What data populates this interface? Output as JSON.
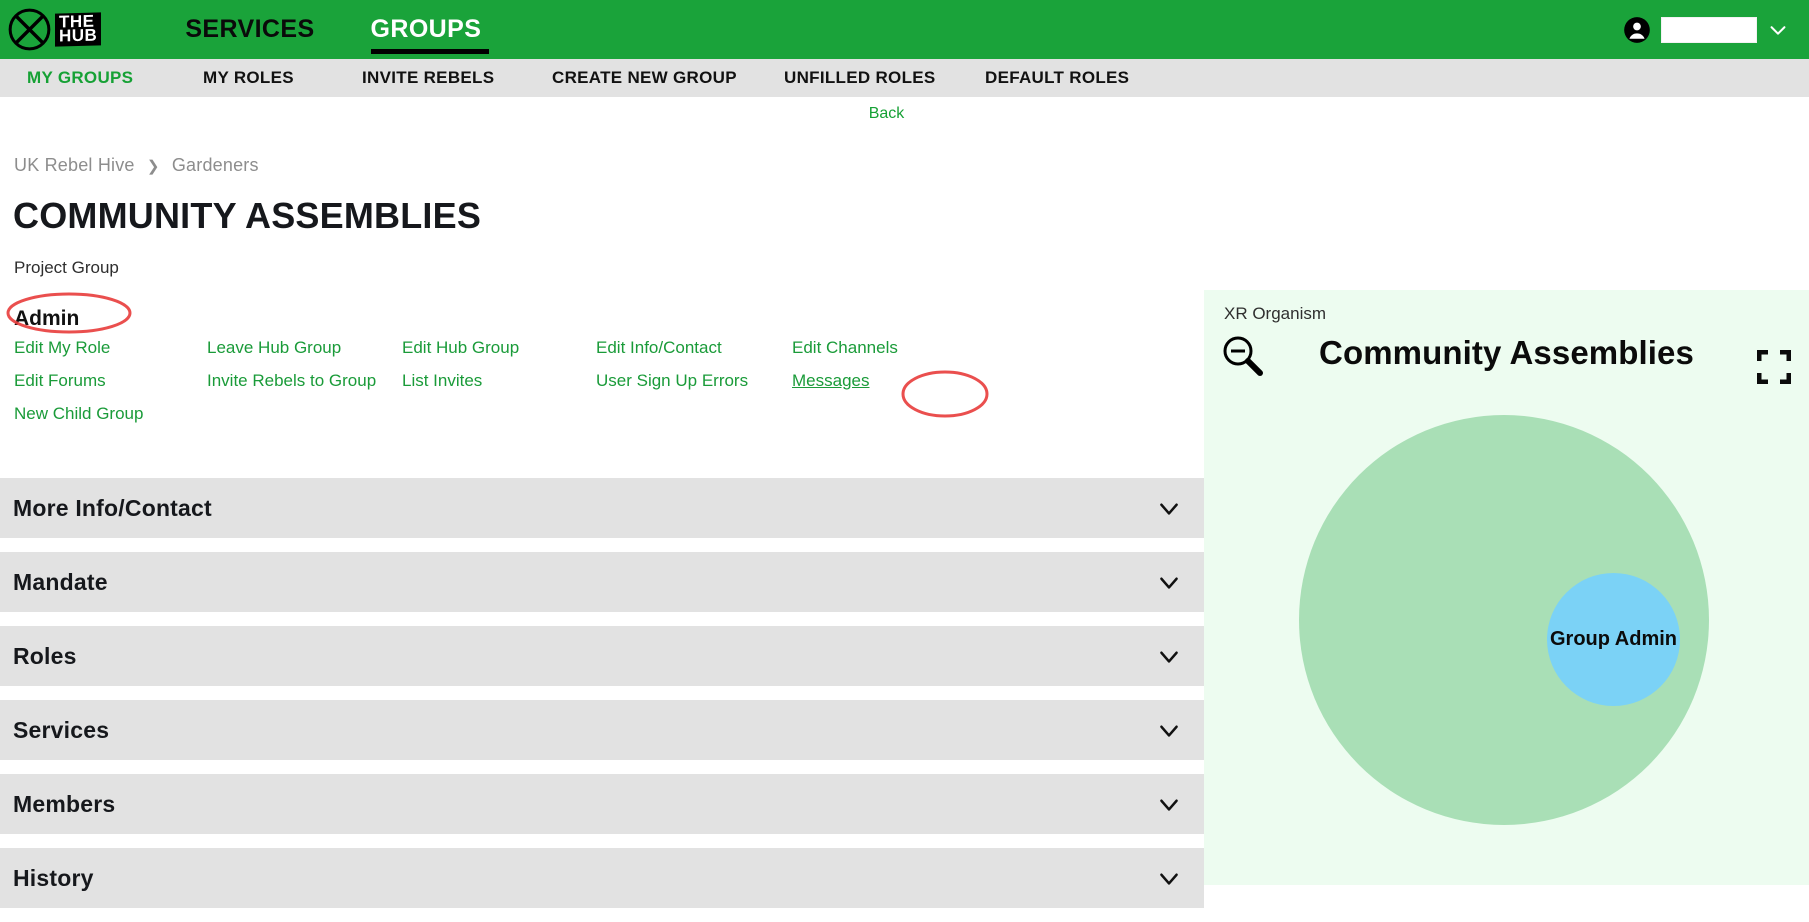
{
  "theme": {
    "brand_green": "#1aa33a",
    "link_green": "#1a9b39",
    "subnav_grey": "#e2e2e2",
    "accordion_grey": "#e2e2e2",
    "annotation_red": "#e8403f",
    "organism_panel_bg": "#edfcf0",
    "organism_outer_circle": "#a9dfb6",
    "organism_inner_circle": "#7bd2f6"
  },
  "header": {
    "logo_icon": "xr-hourglass-logo-icon",
    "logo_badge_line1": "THE",
    "logo_badge_line2": "HUB",
    "nav": [
      {
        "label": "SERVICES",
        "active": false
      },
      {
        "label": "GROUPS",
        "active": true
      }
    ],
    "account": {
      "avatar_icon": "account-circle-icon",
      "user_name": "",
      "chevron_icon": "chevron-down-icon"
    }
  },
  "subnav": {
    "items": [
      {
        "label": "MY GROUPS",
        "current": true
      },
      {
        "label": "MY ROLES",
        "current": false
      },
      {
        "label": "INVITE REBELS",
        "current": false
      },
      {
        "label": "CREATE NEW GROUP",
        "current": false
      },
      {
        "label": "UNFILLED ROLES",
        "current": false
      },
      {
        "label": "DEFAULT ROLES",
        "current": false
      }
    ]
  },
  "back": {
    "label": "Back"
  },
  "page": {
    "breadcrumb": [
      "UK Rebel Hive",
      "Gardeners"
    ],
    "breadcrumb_separator": "❯",
    "title": "COMMUNITY ASSEMBLIES",
    "subtitle": "Project Group"
  },
  "admin": {
    "heading": "Admin",
    "heading_annotated": true,
    "links": [
      {
        "label": "Edit My Role",
        "hovered": false
      },
      {
        "label": "Leave Hub Group",
        "hovered": false
      },
      {
        "label": "Edit Hub Group",
        "hovered": false
      },
      {
        "label": "Edit Info/Contact",
        "hovered": false
      },
      {
        "label": "Edit Channels",
        "hovered": false
      },
      {
        "label": "Edit Forums",
        "hovered": false
      },
      {
        "label": "Invite Rebels to Group",
        "hovered": false
      },
      {
        "label": "List Invites",
        "hovered": false
      },
      {
        "label": "User Sign Up Errors",
        "hovered": false
      },
      {
        "label": "Messages",
        "hovered": true
      },
      {
        "label": "New Child Group",
        "hovered": false
      }
    ]
  },
  "accordion": {
    "sections": [
      {
        "label": "More Info/Contact",
        "expanded": false,
        "chevron_icon": "chevron-down-icon"
      },
      {
        "label": "Mandate",
        "expanded": false,
        "chevron_icon": "chevron-down-icon"
      },
      {
        "label": "Roles",
        "expanded": false,
        "chevron_icon": "chevron-down-icon"
      },
      {
        "label": "Services",
        "expanded": false,
        "chevron_icon": "chevron-down-icon"
      },
      {
        "label": "Members",
        "expanded": false,
        "chevron_icon": "chevron-down-icon"
      },
      {
        "label": "History",
        "expanded": false,
        "chevron_icon": "chevron-down-icon"
      }
    ]
  },
  "organism": {
    "panel_label": "XR Organism",
    "zoom_out_icon": "zoom-out-magnifier-icon",
    "title": "Community Assemblies",
    "fullscreen_icon": "fullscreen-expand-icon",
    "outer_circle_label": "",
    "inner_circle_label": "Group Admin"
  },
  "annotations": [
    {
      "target": "Admin",
      "shape": "ellipse",
      "color": "#e8403f"
    },
    {
      "target": "Messages",
      "shape": "ellipse",
      "color": "#e8403f"
    }
  ]
}
